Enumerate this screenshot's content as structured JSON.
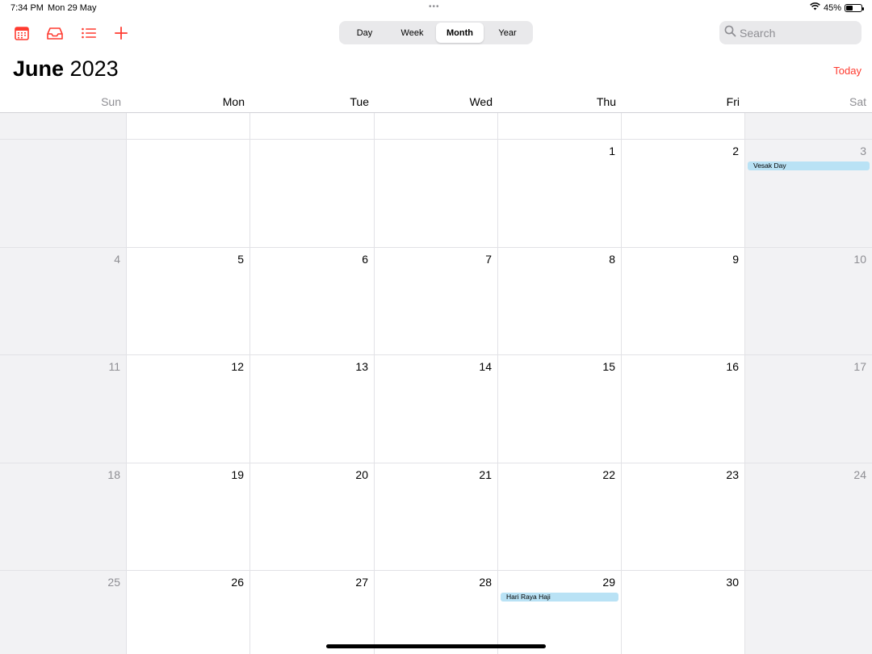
{
  "status_bar": {
    "time": "7:34 PM",
    "date": "Mon 29 May",
    "battery": "45%",
    "battery_level": 0.45
  },
  "toolbar": {
    "icons": [
      "calendar-icon",
      "inbox-icon",
      "list-icon",
      "plus-icon"
    ],
    "segments": [
      "Day",
      "Week",
      "Month",
      "Year"
    ],
    "active_segment": "Month",
    "search_placeholder": "Search"
  },
  "title": {
    "month": "June",
    "year": "2023",
    "today_label": "Today"
  },
  "weekdays": [
    "Sun",
    "Mon",
    "Tue",
    "Wed",
    "Thu",
    "Fri",
    "Sat"
  ],
  "weeks": [
    [
      "",
      "",
      "",
      "",
      "",
      "",
      ""
    ],
    [
      "",
      "",
      "",
      "",
      "1",
      "2",
      "3"
    ],
    [
      "4",
      "5",
      "6",
      "7",
      "8",
      "9",
      "10"
    ],
    [
      "11",
      "12",
      "13",
      "14",
      "15",
      "16",
      "17"
    ],
    [
      "18",
      "19",
      "20",
      "21",
      "22",
      "23",
      "24"
    ],
    [
      "25",
      "26",
      "27",
      "28",
      "29",
      "30",
      ""
    ]
  ],
  "events": [
    {
      "day": "3",
      "title": "Vesak Day"
    },
    {
      "day": "29",
      "title": "Hari Raya Haji"
    }
  ],
  "colors": {
    "accent": "#ff3b30",
    "event_bg": "#b9e2f5",
    "weekend_bg": "#f2f2f4"
  }
}
